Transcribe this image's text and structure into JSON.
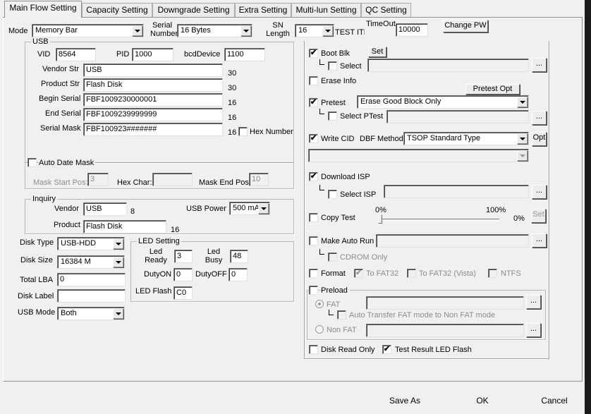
{
  "tabs": [
    "Main Flow Setting",
    "Capacity Setting",
    "Downgrade Setting",
    "Extra Setting",
    "Multi-lun Setting",
    "QC Setting"
  ],
  "top": {
    "mode_label": "Mode",
    "mode_value": "Memory Bar",
    "serial_label": "Serial\nNumber",
    "serial_value": "16 Bytes",
    "sn_label": "SN\nLength",
    "sn_value": "16",
    "test_item_clip": "TEST ITEI",
    "timeout_label": "TimeOut",
    "timeout_value": "10000",
    "change_pw": "Change PW"
  },
  "usb": {
    "title": "USB",
    "vid_label": "VID",
    "vid": "8564",
    "pid_label": "PID",
    "pid": "1000",
    "bcd_label": "bcdDevice",
    "bcd": "1100",
    "vendor_str_label": "Vendor Str",
    "vendor_str": "USB",
    "vendor_str_len": "30",
    "product_str_label": "Product Str",
    "product_str": "Flash Disk",
    "product_str_len": "30",
    "begin_serial_label": "Begin Serial",
    "begin_serial": "FBF1009230000001",
    "begin_serial_len": "16",
    "end_serial_label": "End Serial",
    "end_serial": "FBF1009239999999",
    "end_serial_len": "16",
    "serial_mask_label": "Serial Mask",
    "serial_mask": "FBF100923#######",
    "serial_mask_len": "16",
    "hex_number": "Hex Number",
    "auto_date_mask": "Auto Date Mask",
    "mask_start_label": "Mask Start Pos:",
    "mask_start": "3",
    "hex_char_label": "Hex Char:",
    "hex_char": "",
    "mask_end_label": "Mask End Pos:",
    "mask_end": "10"
  },
  "inquiry": {
    "title": "Inquiry",
    "vendor_label": "Vendor",
    "vendor": "USB",
    "vendor_len": "8",
    "product_label": "Product",
    "product": "Flash Disk",
    "product_len": "16",
    "usb_power_label": "USB Power",
    "usb_power": "500 mA"
  },
  "disk": {
    "type_label": "Disk Type",
    "type": "USB-HDD",
    "size_label": "Disk Size",
    "size": "16384 M",
    "lba_label": "Total LBA",
    "lba": "0",
    "label_label": "Disk Label",
    "label": "",
    "mode_label": "USB Mode",
    "mode": "Both"
  },
  "led": {
    "title": "LED Setting",
    "ready_label": "Led\nReady",
    "ready": "3",
    "busy_label": "Led\nBusy",
    "busy": "48",
    "dutyon_label": "DutyON",
    "dutyon": "0",
    "dutyoff_label": "DutyOFF",
    "dutyoff": "0",
    "flash_label": "LED Flash",
    "flash": "C0"
  },
  "right": {
    "boot_blk": "Boot Blk",
    "set": "Set",
    "select": "Select",
    "browse": "...",
    "erase_info": "Erase Info",
    "pretest_opt": "Pretest Opt",
    "pretest": "Pretest",
    "pretest_value": "Erase Good Block Only",
    "select_ptest": "Select PTest",
    "write_cid": "Write CID",
    "dbf_method": "DBF Method",
    "dbf_value": "TSOP Standard Type",
    "opt": "Opt",
    "download_isp": "Download ISP",
    "select_isp": "Select ISP",
    "copy_test": "Copy Test",
    "pct0": "0%",
    "pct100": "100%",
    "pct_now": "0%",
    "copy_set": "Set",
    "make_auto_run": "Make Auto Run",
    "cdrom_only": "CDROM Only",
    "format": "Format",
    "to_fat32": "To FAT32",
    "to_fat32_vista": "To FAT32 (Vista)",
    "ntfs": "NTFS",
    "preload": "Preload",
    "fat": "FAT",
    "auto_transfer": "Auto Transfer FAT mode to Non FAT mode",
    "non_fat": "Non FAT",
    "disk_read_only": "Disk Read Only",
    "test_result_led": "Test Result LED Flash"
  },
  "checks": {
    "boot_blk": true,
    "select": false,
    "erase_info": false,
    "pretest": true,
    "select_ptest": false,
    "write_cid": true,
    "download_isp": true,
    "select_isp": false,
    "copy_test": false,
    "make_auto_run": false,
    "cdrom_only": false,
    "format": false,
    "to_fat32": true,
    "to_fat32_vista": false,
    "ntfs": false,
    "preload": false,
    "auto_transfer": false,
    "disk_read_only": false,
    "test_result_led": true,
    "hex_number": false,
    "auto_date_mask": false
  },
  "bottom": {
    "save_as": "Save  As",
    "ok": "OK",
    "cancel": "Cancel"
  },
  "icons": {
    "check": "✔"
  }
}
